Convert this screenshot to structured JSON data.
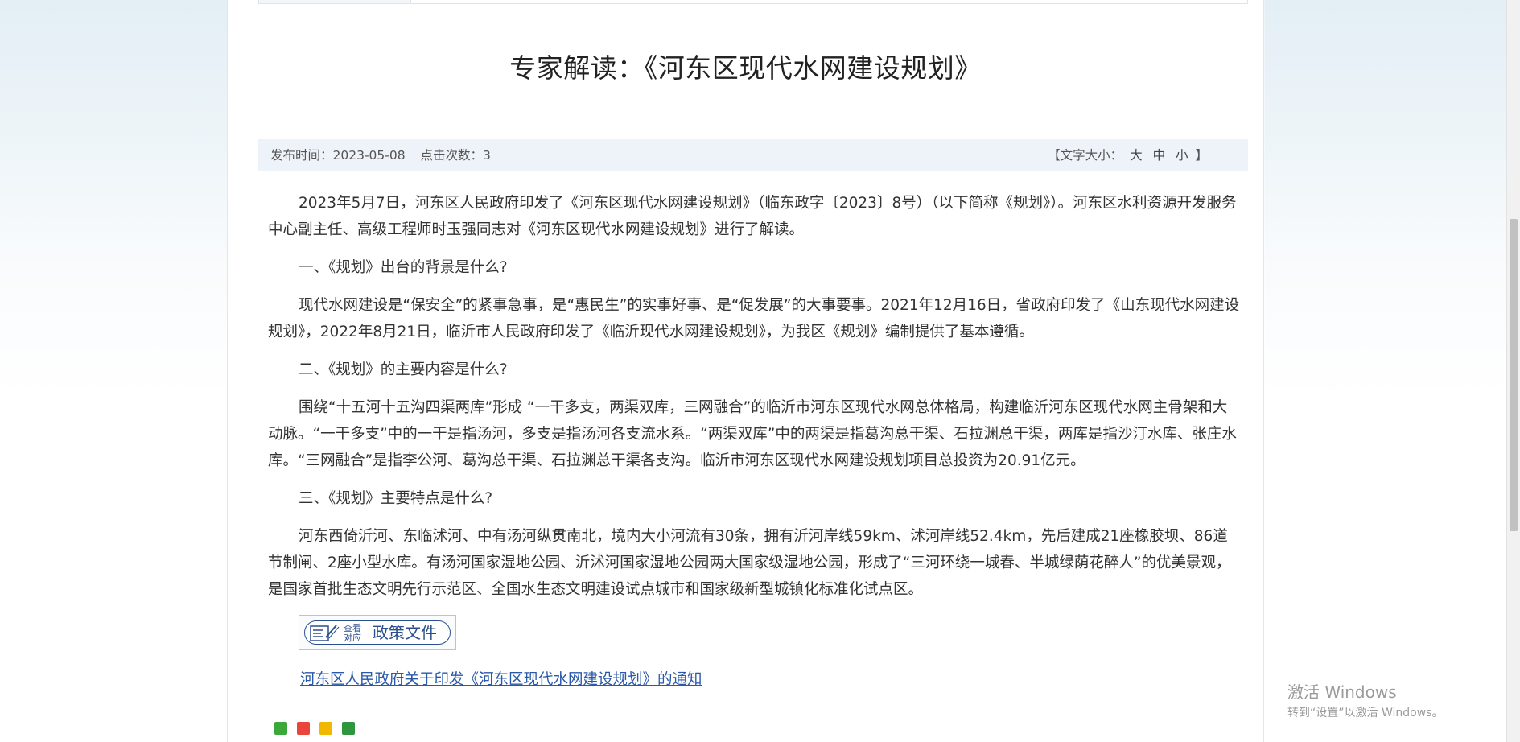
{
  "article": {
    "title": "专家解读：《河东区现代水网建设规划》",
    "meta": {
      "publish_time": "发布时间：2023-05-08",
      "click_count": "点击次数：3",
      "font_size_label_open": "【文字大小：",
      "font_size_large": "大",
      "font_size_medium": "中",
      "font_size_small": "小",
      "font_size_label_close": "】"
    },
    "paragraphs": [
      "2023年5月7日，河东区人民政府印发了《河东区现代水网建设规划》（临东政字〔2023〕8号）（以下简称《规划》）。河东区水利资源开发服务中心副主任、高级工程师时玉强同志对《河东区现代水网建设规划》进行了解读。",
      "一、《规划》出台的背景是什么?",
      "现代水网建设是“保安全”的紧事急事，是“惠民生”的实事好事、是“促发展”的大事要事。2021年12月16日，省政府印发了《山东现代水网建设规划》，2022年8月21日，临沂市人民政府印发了《临沂现代水网建设规划》，为我区《规划》编制提供了基本遵循。",
      "二、《规划》的主要内容是什么?",
      "围绕“十五河十五沟四渠两库”形成 “一干多支，两渠双库，三网融合”的临沂市河东区现代水网总体格局，构建临沂河东区现代水网主骨架和大动脉。“一干多支”中的一干是指汤河，多支是指汤河各支流水系。“两渠双库”中的两渠是指葛沟总干渠、石拉渊总干渠，两库是指沙汀水库、张庄水库。“三网融合”是指李公河、葛沟总干渠、石拉渊总干渠各支沟。临沂市河东区现代水网建设规划项目总投资为20.91亿元。",
      "三、《规划》主要特点是什么?",
      "河东西倚沂河、东临沭河、中有汤河纵贯南北，境内大小河流有30条，拥有沂河岸线59km、沭河岸线52.4km，先后建成21座橡胶坝、86道节制闸、2座小型水库。有汤河国家湿地公园、沂沭河国家湿地公园两大国家级湿地公园，形成了“三河环绕一城春、半城绿荫花醉人”的优美景观，是国家首批生态文明先行示范区、全国水生态文明建设试点城市和国家级新型城镇化标准化试点区。"
    ],
    "policy_button": {
      "small_line1": "查看",
      "small_line2": "对应",
      "big": "政策文件"
    },
    "policy_link": "河东区人民政府关于印发《河东区现代水网建设规划》的通知"
  },
  "share": {
    "icons": [
      "wechat-icon",
      "weibo-icon",
      "qzone-icon",
      "douban-icon"
    ]
  },
  "windows_watermark": {
    "line1": "激活 Windows",
    "line2": "转到“设置”以激活 Windows。"
  }
}
